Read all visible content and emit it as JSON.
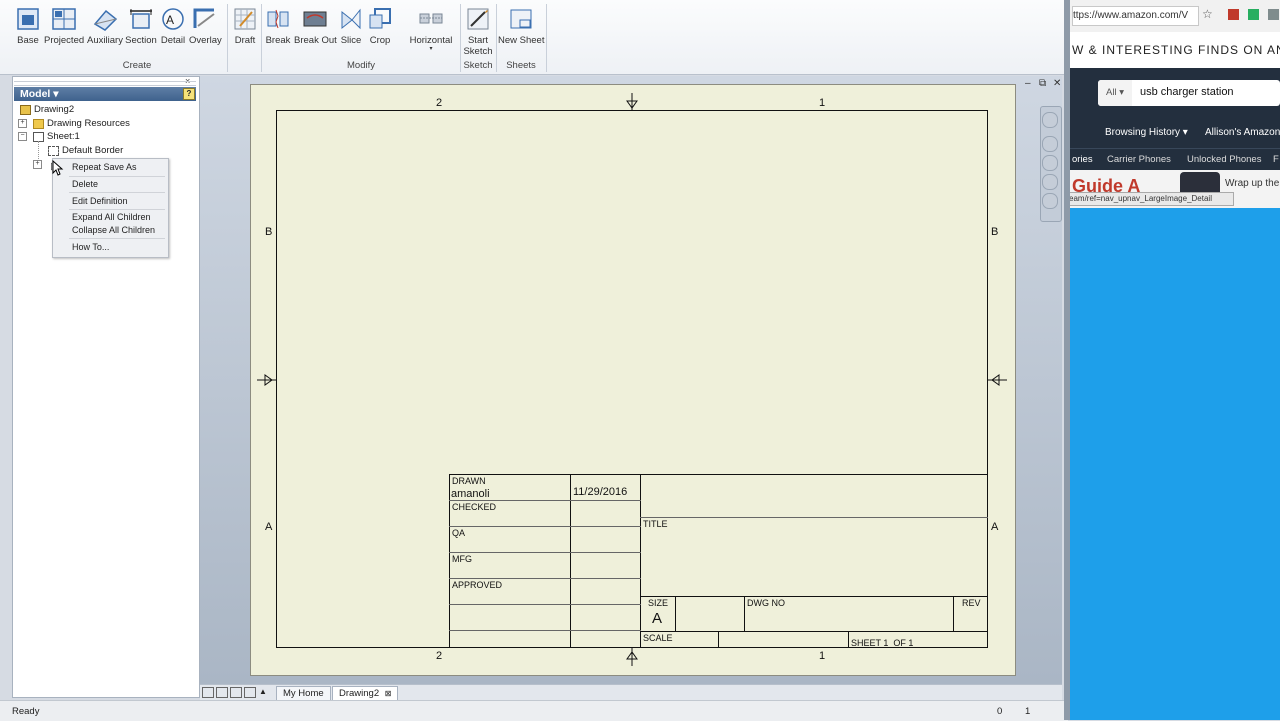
{
  "ribbon": {
    "create_buttons": [
      "Base",
      "Projected",
      "Auxiliary",
      "Section",
      "Detail",
      "Overlay"
    ],
    "modify_buttons": [
      "Draft",
      "Break",
      "Break Out",
      "Slice",
      "Crop"
    ],
    "horizontal_label": "Horizontal",
    "sketch_button": [
      "Start",
      "Sketch"
    ],
    "sheets_button": "New Sheet",
    "groups": {
      "create": "Create",
      "modify": "Modify",
      "sketch": "Sketch",
      "sheets": "Sheets"
    }
  },
  "browser_panel": {
    "title": "Model ▾",
    "help_glyph": "?",
    "tree": {
      "root": "Drawing2",
      "drawing_resources": "Drawing Resources",
      "sheet": "Sheet:1",
      "default_border": "Default Border",
      "title_block_glyph": "⊞"
    }
  },
  "context_menu": {
    "items": [
      "Repeat Save As",
      "Delete",
      "Edit Definition",
      "Expand All Children",
      "Collapse All Children",
      "How To..."
    ]
  },
  "sheet": {
    "zones_top": [
      "2",
      "1"
    ],
    "zones_bottom": [
      "2",
      "1"
    ],
    "zones_left": [
      "B",
      "A"
    ],
    "zones_right": [
      "B",
      "A"
    ],
    "title_block": {
      "drawn_label": "DRAWN",
      "drawn_by": "amanoli",
      "drawn_date": "11/29/2016",
      "checked_label": "CHECKED",
      "qa_label": "QA",
      "mfg_label": "MFG",
      "approved_label": "APPROVED",
      "title_label": "TITLE",
      "size_label": "SIZE",
      "size_value": "A",
      "dwg_no_label": "DWG NO",
      "rev_label": "REV",
      "scale_label": "SCALE",
      "sheet_label": "SHEET 1  OF 1"
    }
  },
  "doc_tabs": {
    "home": "My Home",
    "drawing": "Drawing2",
    "close_glyph": "⊠"
  },
  "status_bar": {
    "text": "Ready",
    "count_a": "0",
    "count_b": "1"
  },
  "window_controls": [
    "‒",
    "⧉",
    "✕"
  ],
  "web_browser": {
    "url": "ttps://www.amazon.com/V",
    "banner": "W & INTERESTING FINDS ON AN",
    "search_scope": "All",
    "search_value": "usb charger station",
    "nav_browsing_history": "Browsing History ▾",
    "nav_account": "Allison's Amazon",
    "sub_nav": [
      "ories",
      "Carrier Phones",
      "Unlocked Phones",
      "F"
    ],
    "hero_text": "Guide A",
    "hero_right": "Wrap up the",
    "tooltip": "eam/ref=nav_upnav_LargeImage_Detail",
    "accent": "#1e9fea"
  }
}
